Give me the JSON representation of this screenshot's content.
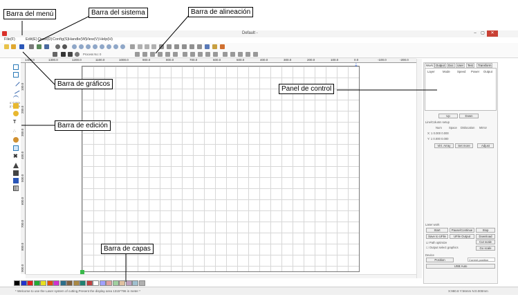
{
  "window": {
    "title": "Default -",
    "minimize": "–",
    "maximize": "▢",
    "close": "✕"
  },
  "menu": {
    "items": [
      "File(F)",
      "Edit(E)",
      "Draw(D)",
      "Config(S)",
      "Handle(W)",
      "View(V)",
      "Help(H)"
    ]
  },
  "params": {
    "line1": "x: 0   mm   100 %",
    "line2": "y: 0   mm   100 %",
    "process_no": "Process No: 0"
  },
  "ruler_top": [
    "1400.0",
    "1300.0",
    "1200.0",
    "1100.0",
    "1000.0",
    "900.0",
    "800.0",
    "700.0",
    "600.0",
    "500.0",
    "400.0",
    "300.0",
    "200.0",
    "100.0",
    "0.0",
    "-100.0",
    "-200.0"
  ],
  "ruler_left": [
    "100.0",
    "200.0",
    "300.0",
    "400.0",
    "500.0",
    "600.0",
    "700.0",
    "800.0",
    "900.0"
  ],
  "layer_colors": [
    "#000000",
    "#2233cc",
    "#e02020",
    "#22aa33",
    "#e8e020",
    "#e05010",
    "#d030d0",
    "#2c6e8a",
    "#806040",
    "#aa8844",
    "#208070",
    "#c04040",
    "#ffffff",
    "#a0a0ff",
    "#e0a0a0",
    "#a0d0a0",
    "#e0c0a0",
    "#c0a0c0",
    "#a0c0d0",
    "#b0b0b0"
  ],
  "panel": {
    "tabs": [
      "Work",
      "Output",
      "Doc",
      "User",
      "Test",
      "Transform"
    ],
    "columns": [
      "Layer",
      "Mode",
      "Speed",
      "Power",
      "Output"
    ],
    "up": "Up",
    "down": "Down",
    "line_section": "Line/Column setup",
    "grid_headers": [
      "Num",
      "Space",
      "Dislocation",
      "Mirror"
    ],
    "row_x": "X:  1      0.000      0.000",
    "row_y": "Y:  1      0.000      0.000",
    "virtual_array": "Virt. Array",
    "set_more": "Set more",
    "adjust": "Adjust",
    "laser_work": "Laser work",
    "start": "Start",
    "pause": "Pause/Continue",
    "stop": "Stop",
    "save_file": "Save to UFile",
    "udisk": "UFile Output",
    "download": "Download",
    "path_optimize": "Path optimize",
    "output_selected": "Output select graphics",
    "cut_scale": "Cut scale",
    "go_scale": "Go scale",
    "device": "Device",
    "position": "Position",
    "current_position": "Current position",
    "usb_auto": "USB:Auto"
  },
  "status": {
    "message": "* Welcome to use the Laser system of cutting,Present the display area 1315*796 in meter *",
    "coord": "X:980.8 Y:56mm   N:0.000mm"
  },
  "annotations": {
    "menu_bar": "Barra del menú",
    "system_bar": "Barra del sistema",
    "align_bar": "Barra de alineación",
    "graphics_bar": "Barra de gráficos",
    "control_panel": "Panel de control",
    "edit_bar": "Barra de edición",
    "layer_bar": "Barra de capas"
  }
}
